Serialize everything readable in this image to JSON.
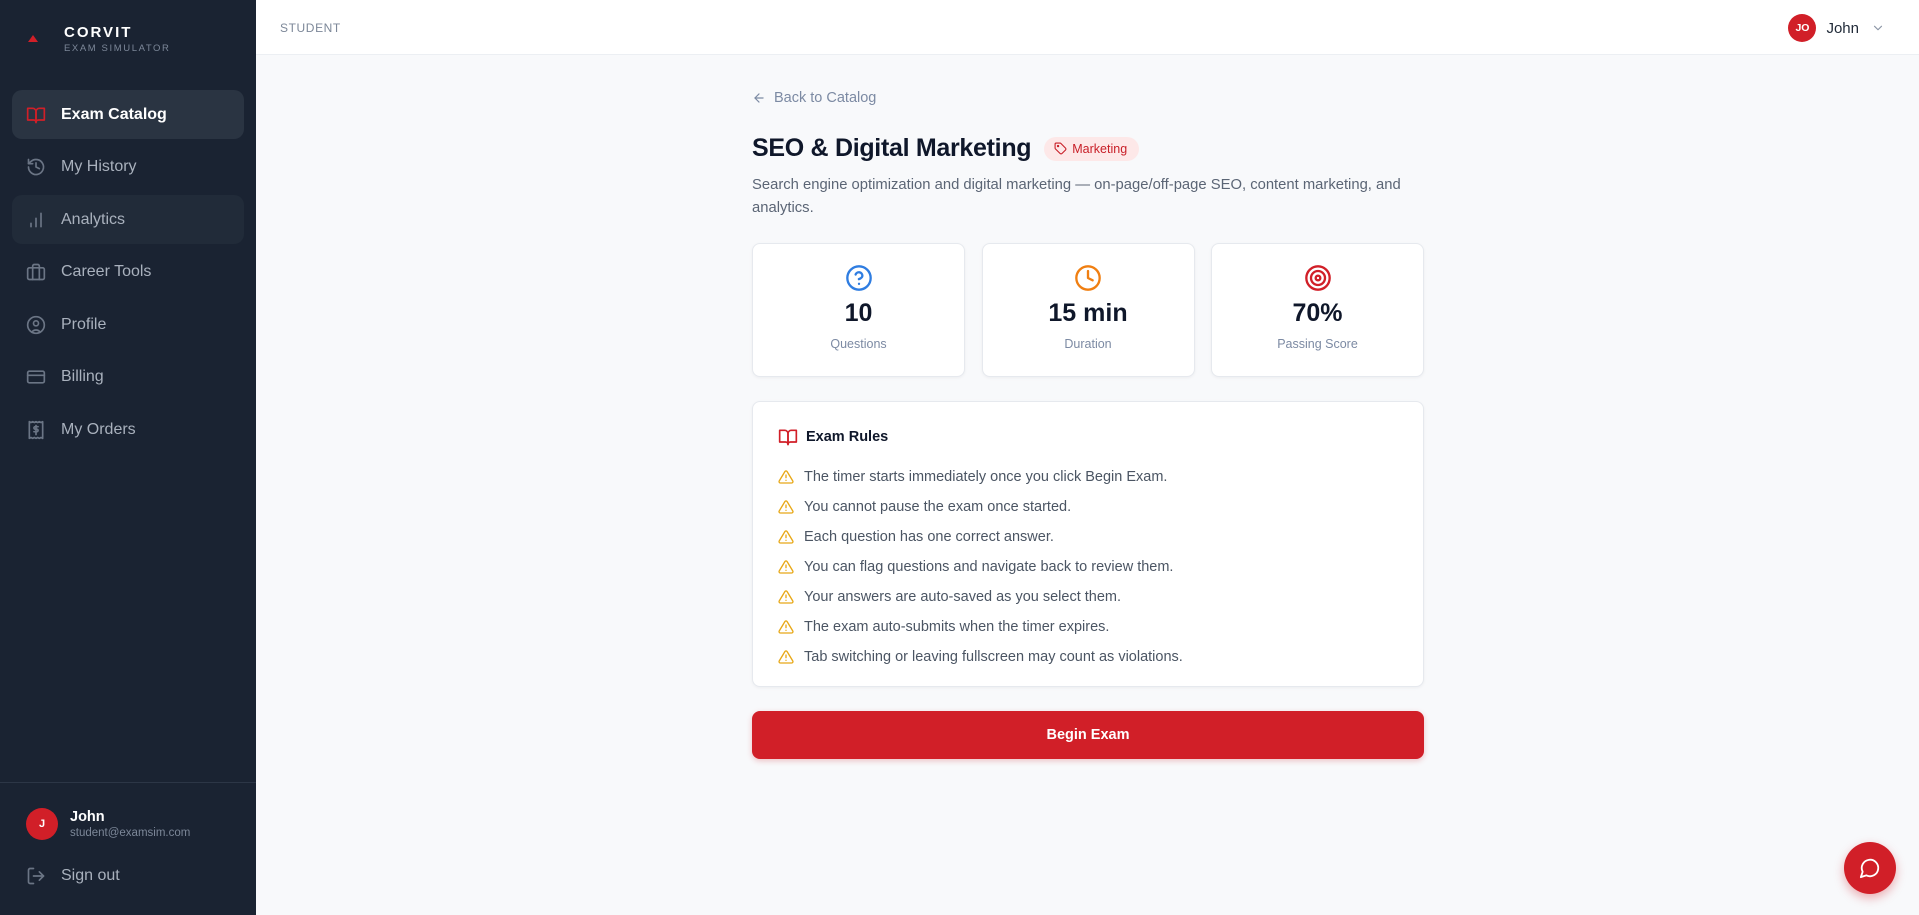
{
  "brand": {
    "name": "CORVIT",
    "subtitle": "EXAM SIMULATOR"
  },
  "sidebar": {
    "items": [
      {
        "label": "Exam Catalog",
        "icon": "book-open-icon",
        "active": true
      },
      {
        "label": "My History",
        "icon": "history-icon"
      },
      {
        "label": "Analytics",
        "icon": "bar-chart-icon"
      },
      {
        "label": "Career Tools",
        "icon": "briefcase-icon"
      },
      {
        "label": "Profile",
        "icon": "user-circle-icon"
      },
      {
        "label": "Billing",
        "icon": "credit-card-icon"
      },
      {
        "label": "My Orders",
        "icon": "receipt-icon"
      }
    ],
    "user": {
      "initial": "J",
      "name": "John",
      "email": "student@examsim.com"
    },
    "signout_label": "Sign out"
  },
  "topbar": {
    "section": "STUDENT",
    "user": {
      "initials": "JO",
      "name": "John"
    }
  },
  "exam": {
    "back_label": "Back to Catalog",
    "title": "SEO & Digital Marketing",
    "tag": "Marketing",
    "description": "Search engine optimization and digital marketing — on-page/off-page SEO, content marketing, and analytics.",
    "stats": [
      {
        "value": "10",
        "label": "Questions",
        "icon": "help-circle-icon"
      },
      {
        "value": "15 min",
        "label": "Duration",
        "icon": "clock-icon"
      },
      {
        "value": "70%",
        "label": "Passing Score",
        "icon": "target-icon"
      }
    ],
    "rules_title": "Exam Rules",
    "rules": [
      "The timer starts immediately once you click Begin Exam.",
      "You cannot pause the exam once started.",
      "Each question has one correct answer.",
      "You can flag questions and navigate back to review them.",
      "Your answers are auto-saved as you select them.",
      "The exam auto-submits when the timer expires.",
      "Tab switching or leaving fullscreen may count as violations."
    ],
    "begin_label": "Begin Exam"
  },
  "colors": {
    "accent": "#d11f28",
    "sidebar_bg": "#1a2332",
    "questions_icon": "#2f7de1",
    "duration_icon": "#f07f12",
    "passing_icon": "#d11f28",
    "warning_icon": "#e8a817"
  }
}
